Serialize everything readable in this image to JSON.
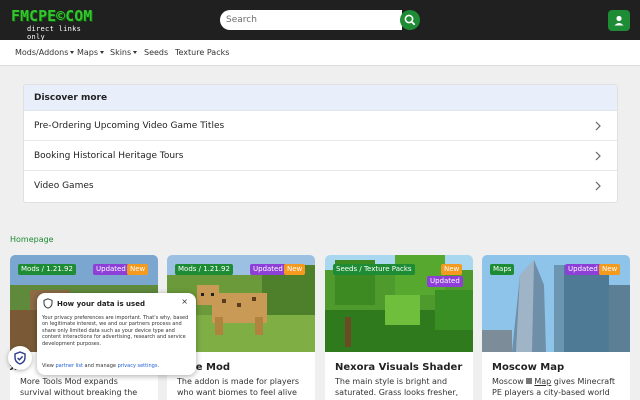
{
  "header": {
    "logo_main": "FMCPE©COM",
    "logo_sub": "direct links only",
    "search_placeholder": "Search"
  },
  "nav": {
    "items": [
      {
        "label": "Mods/Addons",
        "dropdown": true
      },
      {
        "label": "Maps",
        "dropdown": true
      },
      {
        "label": "Skins",
        "dropdown": true
      },
      {
        "label": "Seeds",
        "dropdown": false
      },
      {
        "label": "Texture Packs",
        "dropdown": false
      }
    ]
  },
  "discover": {
    "title": "Discover more",
    "items": [
      "Pre-Ordering Upcoming Video Game Titles",
      "Booking Historical Heritage Tours",
      "Video Games"
    ]
  },
  "section": {
    "title": "Homepage"
  },
  "cards": [
    {
      "title": "More Tools Mod",
      "title_visible": "ols",
      "category": "Mods / 1.21.92",
      "badges": [
        "Updated",
        "New"
      ],
      "desc": "More Tools Mod expands survival without breaking the classic feel of the Tools. The Tools Mod"
    },
    {
      "title": "d Life Mod",
      "category": "Mods / 1.21.92",
      "badges": [
        "Updated",
        "New"
      ],
      "desc": "The addon is made for players who want biomes to feel alive"
    },
    {
      "title": "Nexora Visuals Shader",
      "category": "Seeds / Texture Packs",
      "badges": [
        "New",
        "Updated"
      ],
      "desc": "The main style is bright and saturated. Grass looks fresher, plants feel more alive"
    },
    {
      "title": "Moscow Map",
      "category": "Maps",
      "badges": [
        "Updated",
        "New"
      ],
      "desc_pre": "Moscow ",
      "desc_link": "Map",
      "desc_post": " gives Minecraft PE players a city-based world"
    }
  ],
  "consent": {
    "title": "How your data is used",
    "close": "×",
    "body": "Your privacy preferences are important. That's why, based on legitimate interest, we and our partners process and share only limited data such as your device type and content interactions for advertising, research and service development purposes.",
    "foot_pre": "View ",
    "foot_link1": "partner list",
    "foot_mid": " and manage ",
    "foot_link2": "privacy settings",
    "foot_post": "."
  },
  "colors": {
    "topbar": "#202020",
    "brand_green": "#1e8b35",
    "logo_green": "#35c52f",
    "updated_purple": "#8e3fd8",
    "new_orange": "#f39a1f",
    "discover_head": "#e8effb"
  },
  "icons": [
    "search-icon",
    "user-icon",
    "chevron-right-icon",
    "shield-icon",
    "close-icon"
  ]
}
